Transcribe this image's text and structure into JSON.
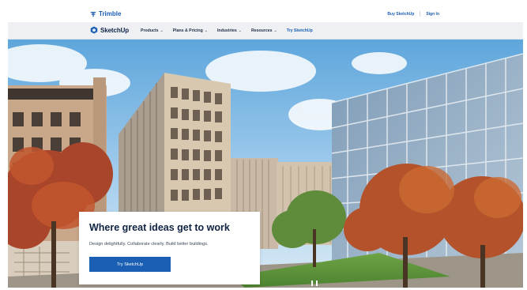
{
  "header": {
    "brand": "Trimble",
    "links": [
      "Buy SketchUp",
      "Sign In"
    ]
  },
  "nav": {
    "logo_text": "SketchUp",
    "items": [
      {
        "label": "Products",
        "chevron": "⌄"
      },
      {
        "label": "Plans & Pricing",
        "chevron": "⌄"
      },
      {
        "label": "Industries",
        "chevron": "⌄"
      },
      {
        "label": "Resources",
        "chevron": "⌄"
      },
      {
        "label": "Try SketchUp",
        "chevron": ""
      }
    ]
  },
  "hero": {
    "title": "Where great ideas get to work",
    "subtitle": "Design delightfully. Collaborate clearly. Build better buildings.",
    "cta_label": "Try SketchUp"
  },
  "colors": {
    "brand_blue": "#1b5fb4",
    "nav_bg": "#eef0f3",
    "title_navy": "#102343"
  },
  "icons": [
    "trimble-logo-icon",
    "sketchup-logo-icon",
    "chevron-down-icon"
  ]
}
